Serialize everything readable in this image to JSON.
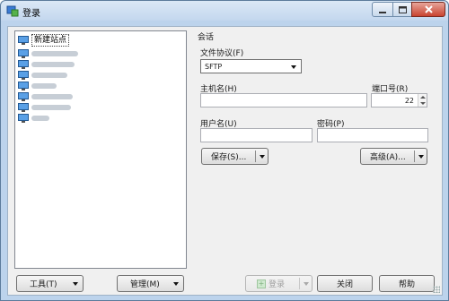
{
  "window": {
    "title": "登录"
  },
  "tree": {
    "items": [
      {
        "label": "新建站点",
        "selected": true
      },
      {
        "label": ""
      },
      {
        "label": ""
      },
      {
        "label": ""
      },
      {
        "label": ""
      },
      {
        "label": ""
      },
      {
        "label": ""
      },
      {
        "label": ""
      }
    ]
  },
  "session": {
    "group_title": "会话",
    "protocol_label": "文件协议(F)",
    "protocol_value": "SFTP",
    "host_label": "主机名(H)",
    "host_value": "",
    "port_label": "端口号(R)",
    "port_value": "22",
    "user_label": "用户名(U)",
    "user_value": "",
    "password_label": "密码(P)",
    "password_value": "",
    "save_label": "保存(S)...",
    "advanced_label": "高级(A)..."
  },
  "bottom": {
    "tools_label": "工具(T)",
    "manage_label": "管理(M)",
    "login_label": "登录",
    "close_label": "关闭",
    "help_label": "帮助"
  }
}
